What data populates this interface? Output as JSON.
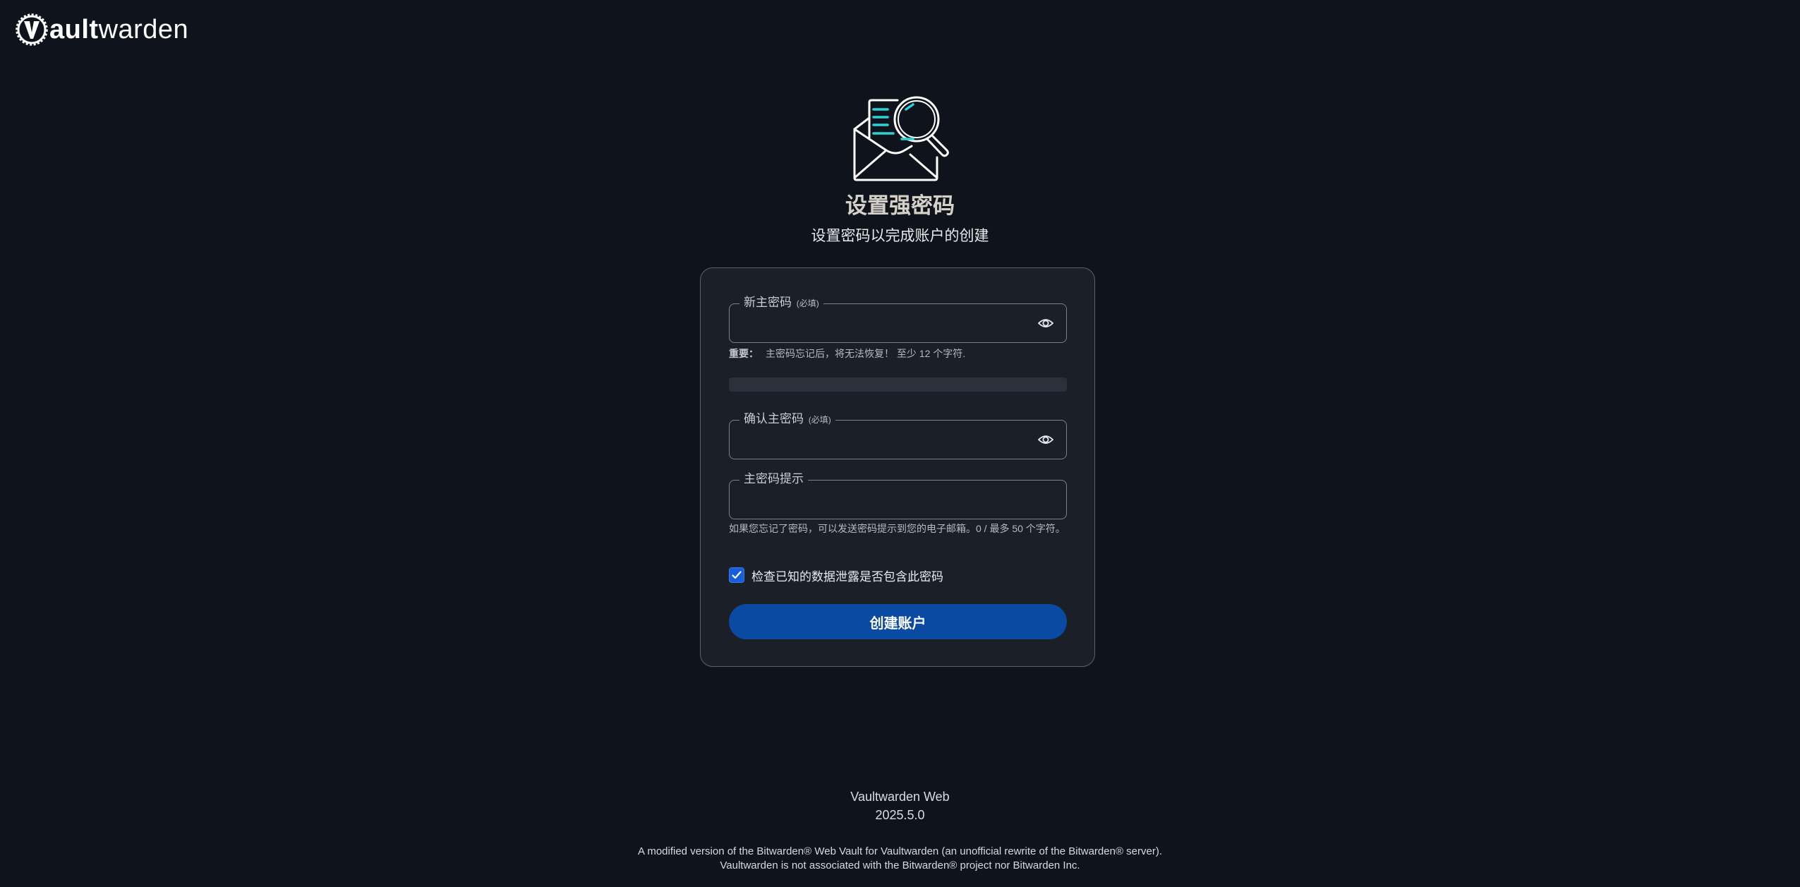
{
  "brand": {
    "logo_bold": "ault",
    "logo_light": "warden",
    "logo_text": "Vaultwarden"
  },
  "page": {
    "title": "设置强密码",
    "subtitle": "设置密码以完成账户的创建"
  },
  "form": {
    "new_password": {
      "label": "新主密码",
      "required": "(必填)",
      "value": ""
    },
    "important_hint": {
      "prefix": "重要：",
      "text": "主密码忘记后，将无法恢复！ 至少 12 个字符."
    },
    "password_strength": 0,
    "confirm_password": {
      "label": "确认主密码",
      "required": "(必填)",
      "value": ""
    },
    "password_hint": {
      "label": "主密码提示",
      "value": "",
      "help": "如果您忘记了密码，可以发送密码提示到您的电子邮箱。0 / 最多 50 个字符。"
    },
    "breach_check": {
      "label": "检查已知的数据泄露是否包含此密码",
      "checked": true
    },
    "submit_label": "创建账户"
  },
  "footer": {
    "app_name": "Vaultwarden Web",
    "version": "2025.5.0",
    "note_line1": "A modified version of the Bitwarden® Web Vault for Vaultwarden (an unofficial rewrite of the Bitwarden® server).",
    "note_line2": "Vaultwarden is not associated with the Bitwarden® project nor Bitwarden Inc."
  },
  "icons": {
    "logo": "vaultwarden-gear-logo",
    "hero": "envelope-magnifier-icon",
    "toggle_visibility": "eye-icon",
    "checkbox": "checkmark-icon"
  },
  "colors": {
    "background": "#0e131c",
    "card": "#1b1f28",
    "primary": "#0a4aa2",
    "checkbox": "#175ddc",
    "accent_teal": "#2bd4d4"
  }
}
